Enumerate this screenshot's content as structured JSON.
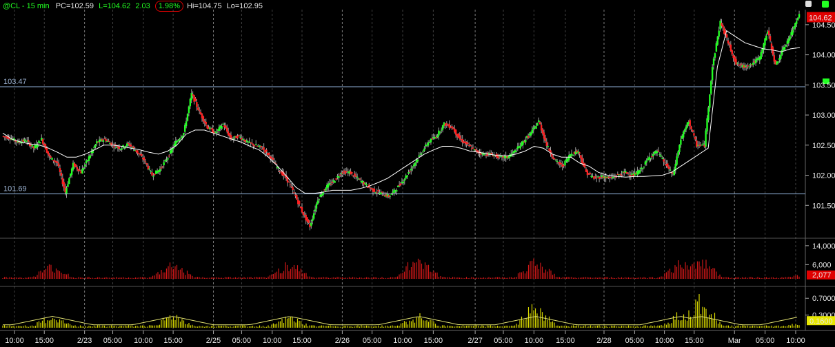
{
  "header": {
    "symbol": "@CL - 15 min",
    "pc": "PC=102.59",
    "last": "L=104.62",
    "chg": "2.03",
    "pct": "1.98%",
    "hi": "Hi=104.75",
    "lo": "Lo=102.95"
  },
  "colors": {
    "up": "#22ff22",
    "down": "#ff2020",
    "ma": "#ffffff",
    "level": "#8fb0d8",
    "grid": "#6a6a6a",
    "volume": "#d01818",
    "indicator": "#d8d800",
    "last_tag": "#e00000",
    "annotation": "#e00000"
  },
  "chart_data": [
    {
      "type": "candlestick",
      "interval": "15 min",
      "ylim": [
        101.0,
        104.75
      ],
      "y_ticks": [
        "104.50",
        "104.00",
        "103.50",
        "103.00",
        "102.50",
        "102.00",
        "101.50"
      ],
      "y_tick_values": [
        104.5,
        104.0,
        103.5,
        103.0,
        102.5,
        102.0,
        101.5
      ],
      "last_price_tag": "104.62",
      "levels": [
        {
          "label": "103.47",
          "value": 103.47
        },
        {
          "label": "101.69",
          "value": 101.69
        }
      ],
      "x_tick_labels": [
        "10:00",
        "15:00",
        "2/23",
        "05:00",
        "10:00",
        "15:00",
        "2/25",
        "05:00",
        "10:00",
        "15:00",
        "2/26",
        "05:00",
        "10:00",
        "15:00",
        "2/27",
        "05:00",
        "10:00",
        "15:00",
        "2/28",
        "05:00",
        "10:00",
        "15:00",
        "Mar",
        "05:00",
        "10:00"
      ],
      "x_tick_fractions": [
        0.018,
        0.055,
        0.105,
        0.14,
        0.178,
        0.215,
        0.265,
        0.3,
        0.338,
        0.375,
        0.425,
        0.462,
        0.5,
        0.538,
        0.59,
        0.625,
        0.663,
        0.702,
        0.75,
        0.788,
        0.825,
        0.862,
        0.912,
        0.95,
        0.988
      ],
      "day_separators": [
        0.105,
        0.265,
        0.425,
        0.59,
        0.75,
        0.912
      ],
      "price_path": [
        102.65,
        102.62,
        102.55,
        102.58,
        102.45,
        102.6,
        102.3,
        102.2,
        101.72,
        102.18,
        102.05,
        102.3,
        102.55,
        102.6,
        102.5,
        102.45,
        102.52,
        102.4,
        102.25,
        102.0,
        102.1,
        102.3,
        102.55,
        102.7,
        103.35,
        103.05,
        102.8,
        102.7,
        102.85,
        102.6,
        102.65,
        102.55,
        102.5,
        102.45,
        102.3,
        102.1,
        101.95,
        101.7,
        101.4,
        101.15,
        101.6,
        101.8,
        101.9,
        102.05,
        102.05,
        101.95,
        101.85,
        101.75,
        101.7,
        101.65,
        101.78,
        101.95,
        102.15,
        102.35,
        102.55,
        102.65,
        102.85,
        102.8,
        102.6,
        102.5,
        102.4,
        102.35,
        102.35,
        102.3,
        102.3,
        102.4,
        102.55,
        102.7,
        102.9,
        102.5,
        102.25,
        102.15,
        102.35,
        102.4,
        102.05,
        101.95,
        101.98,
        101.95,
        102.0,
        102.05,
        102.0,
        102.1,
        102.3,
        102.4,
        102.2,
        102.0,
        102.6,
        102.9,
        102.5,
        102.5,
        103.8,
        104.55,
        104.2,
        103.85,
        103.8,
        103.85,
        103.95,
        104.4,
        103.82,
        104.1,
        104.35,
        104.7
      ],
      "ma_path": [
        102.7,
        102.6,
        102.55,
        102.52,
        102.5,
        102.45,
        102.38,
        102.3,
        102.3,
        102.35,
        102.42,
        102.5,
        102.5,
        102.48,
        102.45,
        102.42,
        102.38,
        102.35,
        102.4,
        102.5,
        102.68,
        102.75,
        102.75,
        102.7,
        102.65,
        102.6,
        102.55,
        102.48,
        102.42,
        102.3,
        102.15,
        101.98,
        101.8,
        101.7,
        101.7,
        101.72,
        101.75,
        101.75,
        101.75,
        101.78,
        101.82,
        101.88,
        101.95,
        102.05,
        102.15,
        102.25,
        102.35,
        102.42,
        102.48,
        102.48,
        102.45,
        102.4,
        102.38,
        102.35,
        102.33,
        102.32,
        102.35,
        102.4,
        102.48,
        102.45,
        102.35,
        102.3,
        102.3,
        102.2,
        102.15,
        102.05,
        102.0,
        101.98,
        101.97,
        101.98,
        101.98,
        101.99,
        102.0,
        102.05,
        102.15,
        102.25,
        102.35,
        102.45,
        103.8,
        104.4,
        104.3,
        104.2,
        104.15,
        104.1,
        104.08,
        104.05,
        104.1,
        104.12
      ]
    },
    {
      "type": "bar",
      "name": "volume",
      "ylim": [
        0,
        16000
      ],
      "y_ticks": [
        "14,000",
        "6,000"
      ],
      "y_tick_values": [
        14000,
        6000
      ],
      "last_value_tag": "2,077",
      "last_value": 2077,
      "session_peaks": [
        {
          "at": 0.065,
          "value": 7500
        },
        {
          "at": 0.215,
          "value": 9000
        },
        {
          "at": 0.36,
          "value": 9500
        },
        {
          "at": 0.52,
          "value": 13000
        },
        {
          "at": 0.665,
          "value": 11000
        },
        {
          "at": 0.845,
          "value": 9000
        },
        {
          "at": 0.87,
          "value": 10500
        },
        {
          "at": 0.87,
          "value": 11000
        },
        {
          "at": 0.995,
          "value": 2077
        }
      ]
    },
    {
      "type": "bar",
      "name": "indicator",
      "ylim": [
        0,
        0.9
      ],
      "y_ticks": [
        "0.7000",
        "0.3000"
      ],
      "y_tick_values": [
        0.7,
        0.3
      ],
      "last_value_tag": "0.1600",
      "last_value": 0.16,
      "session_peaks": [
        {
          "at": 0.065,
          "value": 0.35
        },
        {
          "at": 0.215,
          "value": 0.42
        },
        {
          "at": 0.36,
          "value": 0.33
        },
        {
          "at": 0.52,
          "value": 0.4
        },
        {
          "at": 0.665,
          "value": 0.7
        },
        {
          "at": 0.845,
          "value": 0.45
        },
        {
          "at": 0.87,
          "value": 0.88
        },
        {
          "at": 0.995,
          "value": 0.16
        }
      ]
    }
  ]
}
